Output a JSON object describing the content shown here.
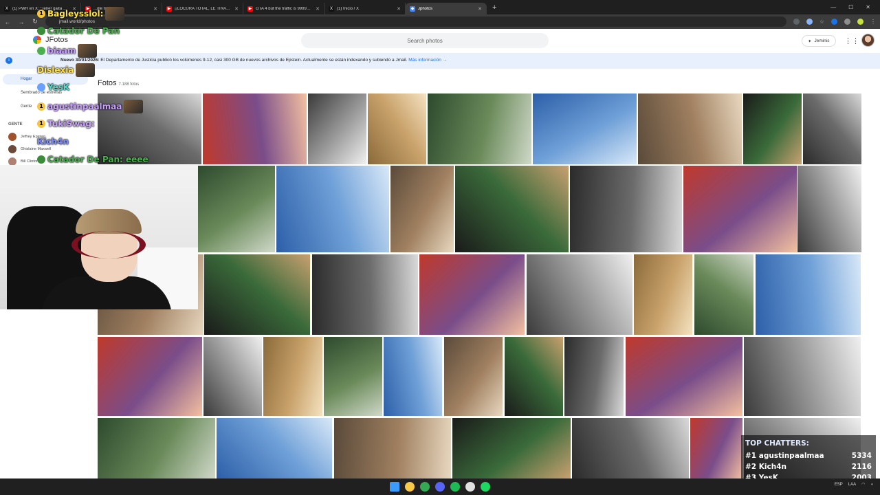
{
  "browser": {
    "tabs": [
      {
        "title": "(1) PWR en X: \"Tener gaita de...",
        "favicon_color": "#111111",
        "favicon_glyph": "X"
      },
      {
        "title": "...gle farming...",
        "favicon_color": "#ff0000",
        "favicon_glyph": "▶"
      },
      {
        "title": "¡¡LOCURA TOTAL, LE TIRARON...",
        "favicon_color": "#ff0000",
        "favicon_glyph": "▶"
      },
      {
        "title": "GTA 4 but the traffic is 9999999...",
        "favicon_color": "#ff0000",
        "favicon_glyph": "▶"
      },
      {
        "title": "(1) Inicio / X",
        "favicon_color": "#111111",
        "favicon_glyph": "X"
      },
      {
        "title": "Jphotos",
        "favicon_color": "#4285f4",
        "favicon_glyph": "◆",
        "active": true
      }
    ],
    "url": "jmail.world/photos"
  },
  "app": {
    "name": "JFotos",
    "search_placeholder": "Search photos",
    "assistant_label": "Jeminis"
  },
  "banner": {
    "lead": "Nuevo 30/01/2026:",
    "text": "El Departamento de Justicia publicó los volúmenes 9-12, casi 300 GB de nuevos archivos de Epstein. Actualmente se están indexando y subiendo a Jmail.",
    "link": "Más información →"
  },
  "sidebar": {
    "items": [
      {
        "label": "Hogar",
        "selected": true
      },
      {
        "label": "Sembrado de estrellas"
      },
      {
        "label": "Gente"
      }
    ],
    "people_heading": "GENTE",
    "people": [
      {
        "name": "Jeffrey Epstein"
      },
      {
        "name": "Ghislaine Maxwell"
      },
      {
        "name": "Bill Clinton"
      }
    ]
  },
  "photos": {
    "title": "Fotos",
    "count": "7.188 fotos"
  },
  "chat_overlay": [
    {
      "user": "Bagleysslol:",
      "color": "#ffe14a",
      "badge": "1",
      "badge_color": "#f5c542",
      "emote": true
    },
    {
      "user": "Catador De Pan",
      "color": "#4caf50",
      "badge": "",
      "badge_color": "#3a8c3a",
      "emote": false
    },
    {
      "user": "biaam",
      "color": "#c9a0ff",
      "badge": "",
      "badge_color": "#4caf50",
      "emote": true
    },
    {
      "user": "Dislexia",
      "color": "#ffe14a",
      "badge": "",
      "badge_color": "",
      "emote": true
    },
    {
      "user": "YesK",
      "color": "#59d4c8",
      "badge": "",
      "badge_color": "#6aa0ff",
      "emote": false
    },
    {
      "user": "agustinpaalmaa",
      "color": "#c9a0ff",
      "badge": "1",
      "badge_color": "#f5c542",
      "emote": true
    },
    {
      "user": "TukiSwag:",
      "color": "#c9a0ff",
      "badge": "1",
      "badge_color": "#f5c542",
      "emote": false
    },
    {
      "user": "Kich4n",
      "color": "#7a8cff",
      "badge": "",
      "badge_color": "",
      "emote": false
    },
    {
      "user": "Catador De Pan: eeee",
      "color": "#4caf50",
      "badge": "",
      "badge_color": "#3a8c3a",
      "emote": false
    }
  ],
  "top_chatters": {
    "heading": "TOP CHATTERS:",
    "rows": [
      {
        "rank": "#1",
        "name": "agustinpaalmaa",
        "count": "5334"
      },
      {
        "rank": "#2",
        "name": "Kich4n",
        "count": "2116"
      },
      {
        "rank": "#3",
        "name": "YesK",
        "count": "2003"
      }
    ]
  },
  "taskbar": {
    "icons": [
      {
        "name": "windows",
        "color": "#3b9cff"
      },
      {
        "name": "explorer",
        "color": "#f7c948"
      },
      {
        "name": "chrome",
        "color": "#34a853"
      },
      {
        "name": "discord",
        "color": "#5865f2"
      },
      {
        "name": "spotify",
        "color": "#1db954"
      },
      {
        "name": "obs",
        "color": "#e0e0e0"
      },
      {
        "name": "app",
        "color": "#1ed760"
      }
    ],
    "lang": "ESP",
    "region": "LAA"
  },
  "colors": {
    "accent": "#1a73e8",
    "banner_bg": "#e8f0fe",
    "selected_bg": "#e8f0fe"
  }
}
